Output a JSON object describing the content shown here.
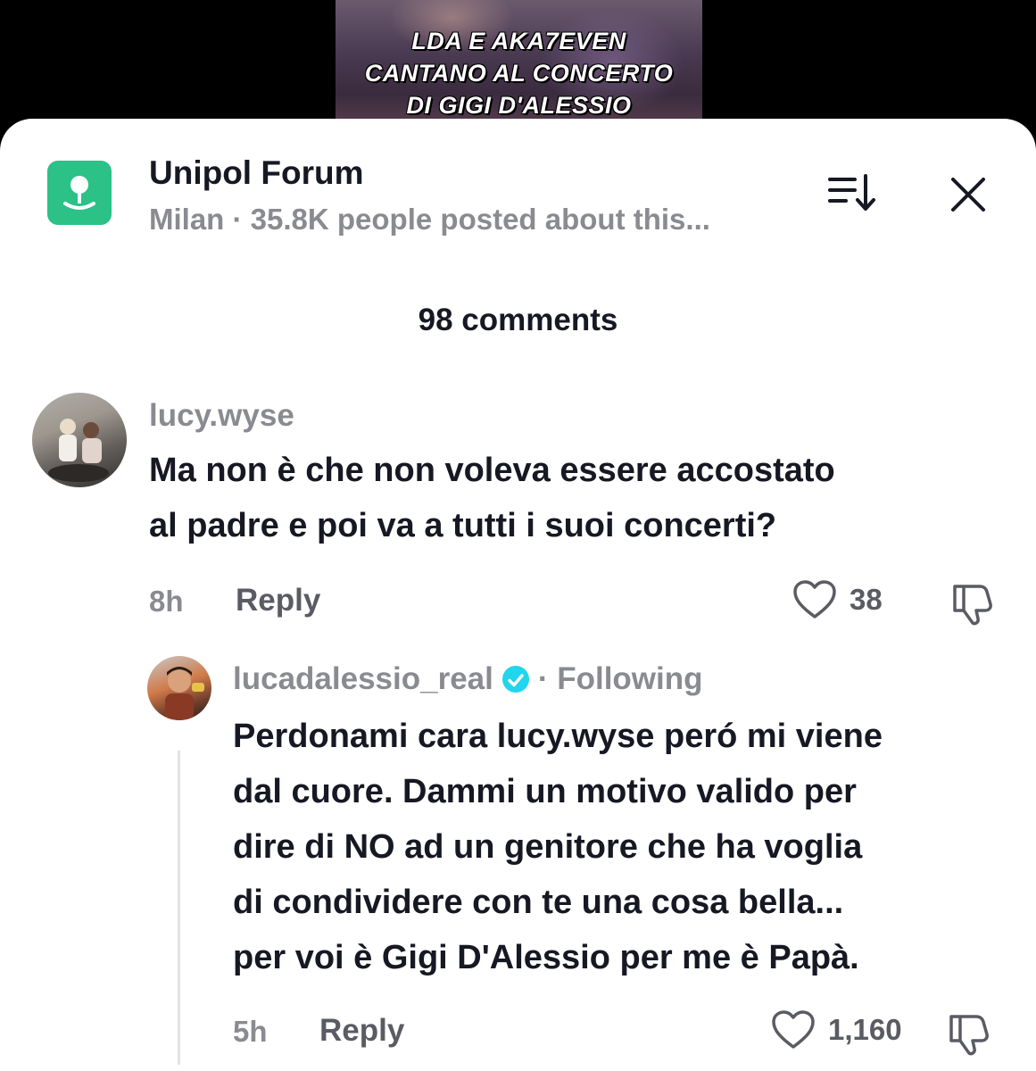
{
  "video": {
    "caption_lines": [
      "LDA E AKA7EVEN",
      "CANTANO AL CONCERTO",
      "DI GIGI D'ALESSIO"
    ]
  },
  "location": {
    "title": "Unipol Forum",
    "subtitle": "Milan · 35.8K people posted about this...",
    "icon": "location-pin-icon",
    "accent_color": "#2bc187"
  },
  "comments_header": "98 comments",
  "comments": [
    {
      "username": "lucy.wyse",
      "text_lines": [
        "Ma non è che non voleva essere accostato",
        "al padre e poi va a tutti i suoi concerti?"
      ],
      "time": "8h",
      "reply_label": "Reply",
      "likes": "38"
    },
    {
      "username": "lucadalessio_real",
      "verified": true,
      "following_label": "· Following",
      "text_lines": [
        "Perdonami cara lucy.wyse peró mi viene",
        "dal cuore. Dammi un motivo valido per",
        "dire di NO ad un genitore che ha voglia",
        "di condividere con te una cosa bella...",
        "per voi è Gigi D'Alessio per me è Papà."
      ],
      "time": "5h",
      "reply_label": "Reply",
      "likes": "1,160"
    }
  ],
  "colors": {
    "primary_text": "#161823",
    "secondary_text": "#8a8b91",
    "verified_badge": "#20d5ec"
  }
}
